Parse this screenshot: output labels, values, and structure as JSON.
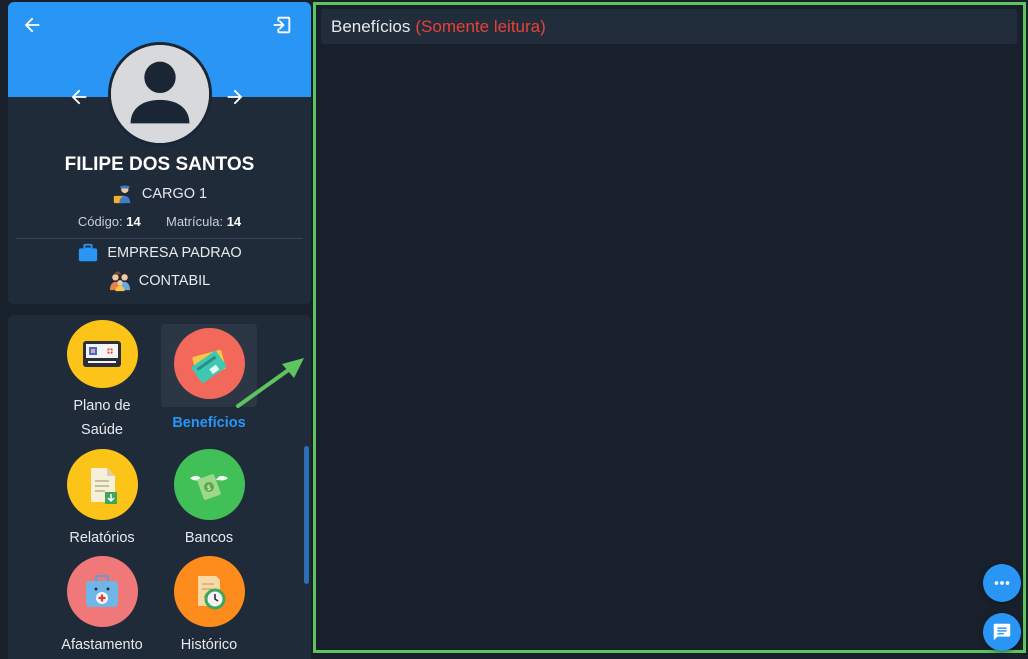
{
  "profile": {
    "name": "FILIPE DOS SANTOS",
    "cargo": "CARGO 1",
    "codigo_label": "Código:",
    "codigo_value": "14",
    "matricula_label": "Matrícula:",
    "matricula_value": "14",
    "empresa": "EMPRESA PADRAO",
    "departamento": "CONTABIL"
  },
  "menu": {
    "items": [
      {
        "label": "Plano de Saúde",
        "icon": "health-card-icon"
      },
      {
        "label": "Benefícios",
        "icon": "benefit-cards-icon",
        "active": true
      },
      {
        "label": "Relatórios",
        "icon": "report-download-icon"
      },
      {
        "label": "Bancos",
        "icon": "money-wings-icon"
      },
      {
        "label": "Afastamento",
        "icon": "first-aid-kit-icon"
      },
      {
        "label": "Histórico",
        "icon": "history-clock-icon"
      }
    ]
  },
  "main": {
    "title": "Benefícios",
    "readonly_tag": "(Somente leitura)"
  },
  "colors": {
    "accent": "#2996f5",
    "frame_border": "#5ec45e",
    "readonly": "#e8403a",
    "background": "#18212b",
    "card": "#202b3a"
  }
}
